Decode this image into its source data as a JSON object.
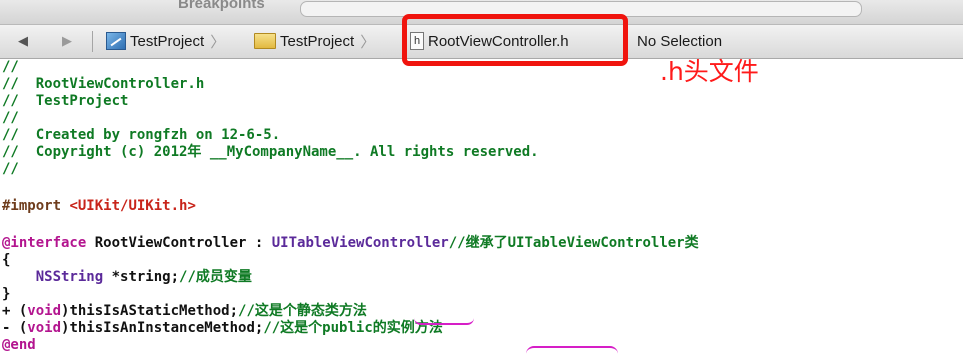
{
  "toolbar": {
    "breakpoints_label": "Breakpoints"
  },
  "jumpbar": {
    "back_arrow": "◀",
    "forward_arrow": "▶",
    "crumbs": [
      "TestProject",
      "TestProject",
      "RootViewController.h"
    ],
    "no_selection": "No Selection"
  },
  "annotation": {
    "header_file": ".h头文件"
  },
  "code": {
    "l1": "//",
    "l2": "//  RootViewController.h",
    "l3": "//  TestProject",
    "l4": "//",
    "l5": "//  Created by rongfzh on 12-6-5.",
    "l6": "//  Copyright (c) 2012年 __MyCompanyName__. All rights reserved.",
    "l7": "//",
    "import_kw": "#import ",
    "import_path": "<UIKit/UIKit.h>",
    "iface_kw": "@interface",
    "iface_name": " RootViewController : ",
    "iface_super": "UITableViewController",
    "iface_comment": "//继承了UITableViewController类",
    "brace_open": "{",
    "ivar_type": "    NSString",
    "ivar_name": " *string;",
    "ivar_comment": "//成员变量",
    "brace_close": "}",
    "m1_prefix": "+ (",
    "m1_void": "void",
    "m1_name": ")thisIsAStaticMethod;",
    "m1_comment": "//这是个静态类方法",
    "m2_prefix": "- (",
    "m2_void": "void",
    "m2_name": ")thisIsAnInstanceMethod;",
    "m2_comment": "//这是个public的实例方法",
    "end": "@end"
  },
  "colors": {
    "comment": "#0f7a24",
    "string": "#c8241a",
    "keyword": "#b3158f",
    "annotation_red": "#f0140e",
    "underline_magenta": "#d61ec7"
  }
}
